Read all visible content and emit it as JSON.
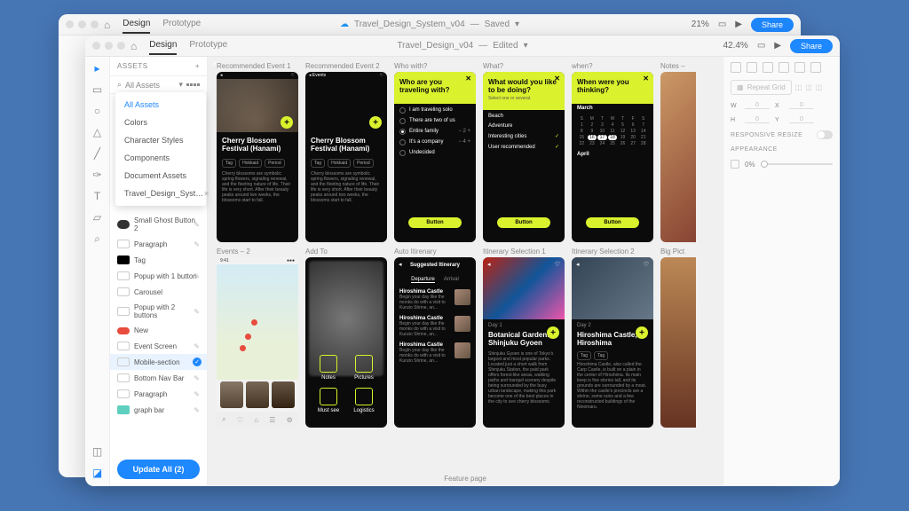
{
  "back_window": {
    "tabs": [
      "Design",
      "Prototype"
    ],
    "doc_name": "Travel_Design_System_v04",
    "save_state": "Saved",
    "zoom": "21%",
    "share": "Share"
  },
  "front_window": {
    "tabs": [
      "Design",
      "Prototype"
    ],
    "doc_name": "Travel_Design_v04",
    "save_state": "Edited",
    "zoom": "42.4%",
    "share": "Share"
  },
  "assets": {
    "title": "ASSETS",
    "filter_label": "All Assets",
    "flyout": [
      "All Assets",
      "Colors",
      "Character Styles",
      "Components",
      "Document Assets",
      "Travel_Design_Syst…"
    ],
    "items": [
      "Small Ghost Button 2",
      "Paragraph",
      "Tag",
      "Popup with 1 button",
      "Carousel",
      "Popup with 2 buttons",
      "New",
      "Event Screen",
      "Mobile-section",
      "Bottom Nav Bar",
      "Paragraph",
      "graph bar"
    ],
    "update_label": "Update All (2)"
  },
  "artboards_row1": {
    "labels": [
      "Recommended Event 1",
      "Recommended Event 2",
      "Who with?",
      "What?",
      "when?",
      "Notes –"
    ],
    "event1_title": "Cherry Blossom Festival (Hanami)",
    "event1_tags": [
      "Tag",
      "Hokkaid",
      "Period"
    ],
    "event1_desc": "Cherry blossoms are symbolic spring flowers, signaling renewal, and the fleeting nature of life. Their life is very short. After their beauty peaks around two weeks, the blossoms start to fall.",
    "event2_title": "Cherry Blossom Festival (Hanami)",
    "who_head": "Who are you traveling with?",
    "who_opts": [
      "I am traveling solo",
      "There are two of us",
      "Entire family",
      "It's a company",
      "Undecided"
    ],
    "what_head": "What would you like to be doing?",
    "what_sub": "Select one or several.",
    "what_opts": [
      "Beach",
      "Adventure",
      "Interesting cities",
      "User recommended"
    ],
    "when_head": "When were you thinking?",
    "when_m1": "March",
    "when_m2": "April",
    "button_label": "Button"
  },
  "artboards_row2": {
    "labels": [
      "Events – 2",
      "Add To",
      "Auto Itirenary",
      "Itinerary Selection 1",
      "Itinerary Selection 2",
      "Big Pict"
    ],
    "addto_icons": [
      "Notes",
      "Pictures",
      "Must see",
      "Logistics"
    ],
    "itin_head": "Suggested Itinerary",
    "itin_tabs": [
      "Departure",
      "Arrival"
    ],
    "itin_card_title": "Hiroshima Castle",
    "itin_card_desc": "Begin your day like the monks do with a visit to Kuruto Shrine, an...",
    "sel1_day": "Day 1",
    "sel1_place": "Botanical Gardens, Shinjuku Gyoen",
    "sel1_desc": "Shinjuku Gyoen is one of Tokyo's largest and most popular parks. Located just a short walk from Shinjuku Station, the paid park offers forest-like areas, walking paths and tranquil scenery despite being surrounded by the busy urban landscape, making this park become one of the best places in the city to see cherry blossoms.",
    "sel2_day": "Day 2",
    "sel2_place": "Hiroshima Castle, Hiroshima",
    "sel2_desc": "Hiroshima Castle, also called the Carp Castle, is built on a plain in the center of Hiroshima. Its main keep is five stories tall, and its grounds are surrounded by a moat. Within the castle's precincts are a shrine, some ruins and a few reconstructed buildings of the Ninomaru."
  },
  "bottom_label": "Feature page",
  "right_panel": {
    "repeat_grid": "Repeat Grid",
    "w": "W",
    "h": "H",
    "x": "X",
    "y": "Y",
    "w_val": "0",
    "x_val": "0",
    "h_val": "0",
    "y_val": "0",
    "resize": "RESPONSIVE RESIZE",
    "appearance": "APPEARANCE",
    "opacity": "0%"
  }
}
